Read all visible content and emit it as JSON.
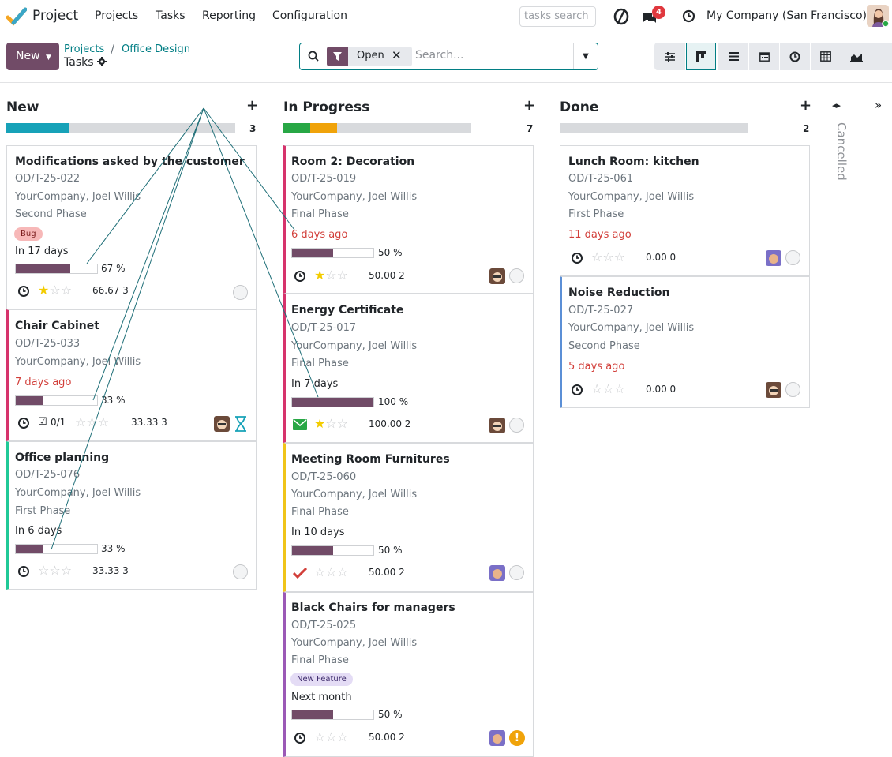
{
  "navbar": {
    "app_name": "Project",
    "menus": [
      "Projects",
      "Tasks",
      "Reporting",
      "Configuration"
    ],
    "search_placeholder": "tasks search",
    "chat_count": "4",
    "company": "My Company (San Francisco)"
  },
  "control": {
    "new_label": "New",
    "breadcrumb_parent": "Projects",
    "breadcrumb_current": "Office Design",
    "title": "Tasks",
    "facet_label": "Open",
    "search_placeholder": "Search..."
  },
  "columns": [
    {
      "title": "New",
      "count": "3"
    },
    {
      "title": "In Progress",
      "count": "7"
    },
    {
      "title": "Done",
      "count": "2"
    }
  ],
  "folded_column": "Cancelled",
  "cards": {
    "c1": {
      "title": "Modifications asked by the customer",
      "ref": "OD/T-25-022",
      "customer": "YourCompany, Joel Willis",
      "phase": "Second Phase",
      "tag": "Bug",
      "deadline": "In 17 days",
      "progress": "67 %",
      "progress_value": 67,
      "meta": "66.67 3",
      "stars": 1
    },
    "c2": {
      "title": "Chair Cabinet",
      "ref": "OD/T-25-033",
      "customer": "YourCompany, Joel Willis",
      "deadline": "7 days ago",
      "progress": "33 %",
      "progress_value": 33,
      "subtasks": "0/1",
      "meta": "33.33 3",
      "stars": 0
    },
    "c3": {
      "title": "Office planning",
      "ref": "OD/T-25-076",
      "customer": "YourCompany, Joel Willis",
      "phase": "First Phase",
      "deadline": "In 6 days",
      "progress": "33 %",
      "progress_value": 33,
      "meta": "33.33 3",
      "stars": 0
    },
    "c4": {
      "title": "Room 2: Decoration",
      "ref": "OD/T-25-019",
      "customer": "YourCompany, Joel Willis",
      "phase": "Final Phase",
      "deadline": "6 days ago",
      "progress": "50 %",
      "progress_value": 50,
      "meta": "50.00 2",
      "stars": 1
    },
    "c5": {
      "title": "Energy Certificate",
      "ref": "OD/T-25-017",
      "customer": "YourCompany, Joel Willis",
      "phase": "Final Phase",
      "deadline": "In 7 days",
      "progress": "100 %",
      "progress_value": 100,
      "meta": "100.00 2",
      "stars": 1
    },
    "c6": {
      "title": "Meeting Room Furnitures",
      "ref": "OD/T-25-060",
      "customer": "YourCompany, Joel Willis",
      "phase": "Final Phase",
      "deadline": "In 10 days",
      "progress": "50 %",
      "progress_value": 50,
      "meta": "50.00 2",
      "stars": 0
    },
    "c7": {
      "title": "Black Chairs for managers",
      "ref": "OD/T-25-025",
      "customer": "YourCompany, Joel Willis",
      "phase": "Final Phase",
      "tag": "New Feature",
      "deadline": "Next month",
      "progress": "50 %",
      "progress_value": 50,
      "meta": "50.00 2",
      "stars": 0
    },
    "c8": {
      "title": "Lunch Room: kitchen",
      "ref": "OD/T-25-061",
      "customer": "YourCompany, Joel Willis",
      "phase": "First Phase",
      "deadline": "11 days ago",
      "meta": "0.00 0",
      "stars": 0
    },
    "c9": {
      "title": "Noise Reduction",
      "ref": "OD/T-25-027",
      "customer": "YourCompany, Joel Willis",
      "phase": "Second Phase",
      "deadline": "5 days ago",
      "meta": "0.00 0",
      "stars": 0
    }
  },
  "colors": {
    "brand": "#714b67",
    "teal": "#017e84",
    "danger": "#d23f3a"
  }
}
